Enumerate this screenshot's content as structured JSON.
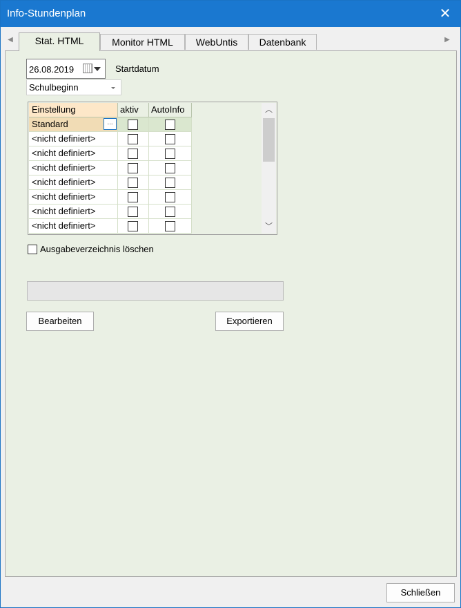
{
  "window": {
    "title": "Info-Stundenplan",
    "close_icon": "close-icon"
  },
  "tabs": [
    {
      "label": "Stat. HTML",
      "active": true
    },
    {
      "label": "Monitor HTML",
      "active": false
    },
    {
      "label": "WebUntis",
      "active": false
    },
    {
      "label": "Datenbank",
      "active": false
    }
  ],
  "date": {
    "value": "26.08.2019",
    "label": "Startdatum"
  },
  "start_combo": {
    "value": "Schulbeginn"
  },
  "grid": {
    "columns": [
      "Einstellung",
      "aktiv",
      "AutoInfo"
    ],
    "rows": [
      {
        "name": "Standard",
        "aktiv": false,
        "autoinfo": false,
        "selected": true
      },
      {
        "name": "<nicht definiert>",
        "aktiv": false,
        "autoinfo": false
      },
      {
        "name": "<nicht definiert>",
        "aktiv": false,
        "autoinfo": false
      },
      {
        "name": "<nicht definiert>",
        "aktiv": false,
        "autoinfo": false
      },
      {
        "name": "<nicht definiert>",
        "aktiv": false,
        "autoinfo": false
      },
      {
        "name": "<nicht definiert>",
        "aktiv": false,
        "autoinfo": false
      },
      {
        "name": "<nicht definiert>",
        "aktiv": false,
        "autoinfo": false
      },
      {
        "name": "<nicht definiert>",
        "aktiv": false,
        "autoinfo": false
      }
    ],
    "ellipsis": "..."
  },
  "options": {
    "clear_output_label": "Ausgabeverzeichnis löschen",
    "clear_output_checked": false
  },
  "buttons": {
    "edit": "Bearbeiten",
    "export": "Exportieren",
    "close": "Schließen"
  }
}
